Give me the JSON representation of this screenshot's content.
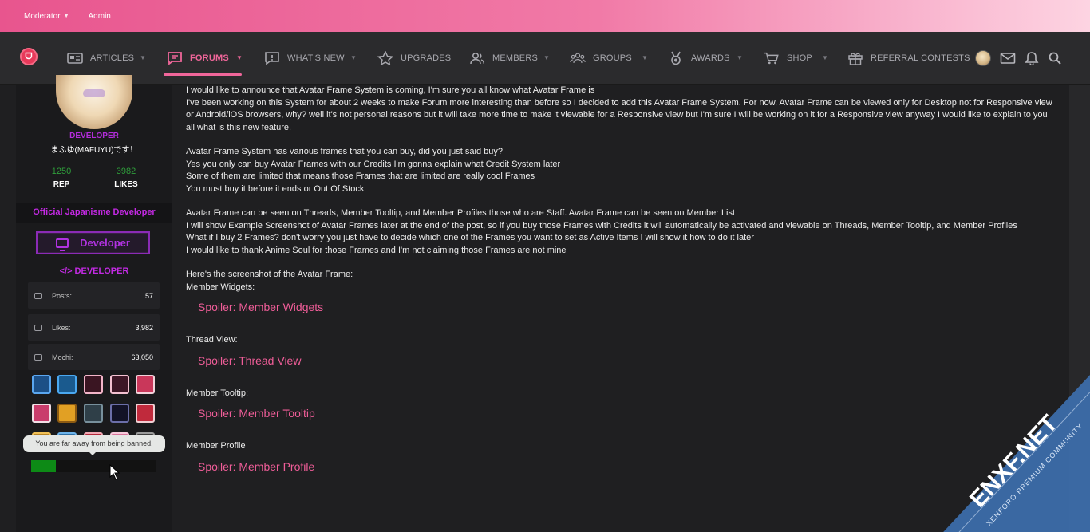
{
  "topbar": {
    "items": [
      "Moderator",
      "Admin"
    ]
  },
  "nav": {
    "items": [
      {
        "label": "ARTICLES",
        "icon": "newspaper-icon"
      },
      {
        "label": "FORUMS",
        "icon": "comment-icon"
      },
      {
        "label": "WHAT'S NEW",
        "icon": "alert-icon"
      },
      {
        "label": "UPGRADES",
        "icon": "star-icon"
      },
      {
        "label": "MEMBERS",
        "icon": "user-group-icon"
      },
      {
        "label": "GROUPS",
        "icon": "users-icon"
      },
      {
        "label": "AWARDS",
        "icon": "medal-icon"
      },
      {
        "label": "SHOP",
        "icon": "cart-icon"
      },
      {
        "label": "REFERRAL CONTESTS",
        "icon": "gift-icon"
      }
    ]
  },
  "sidebar": {
    "role": "DEVELOPER",
    "username": "まふゆ(MAFUYU)です！",
    "stats": [
      {
        "value": "1250",
        "label": "REP"
      },
      {
        "value": "3982",
        "label": "LIKES"
      }
    ],
    "banner": "Official Japanisme Developer",
    "developer_button": "Developer",
    "developer_tag": "</> DEVELOPER",
    "rows": [
      {
        "label": "Posts:",
        "value": "57"
      },
      {
        "label": "Likes:",
        "value": "3,982"
      },
      {
        "label": "Mochi:",
        "value": "63,050"
      }
    ],
    "tooltip": "You are far away from being banned.",
    "progress": 0.2
  },
  "post": {
    "paragraphs": [
      [
        "I would like to announce that Avatar Frame System is coming, I'm sure you all know what Avatar Frame is",
        "I've been working on this System for about 2 weeks to make Forum more interesting than before so I decided to add this Avatar Frame System. For now, Avatar Frame can be viewed only for Desktop not for Responsive view or Android/iOS browsers, why? well it's not personal reasons but it will take more time to make it viewable for a Responsive view but I'm sure I will be working on it for a Responsive view anyway I would like to explain to you all what is this new feature."
      ],
      [
        "Avatar Frame System has various frames that you can buy, did you just said buy?",
        "Yes you only can buy Avatar Frames with our Credits I'm gonna explain what Credit System later",
        "Some of them are limited that means those Frames that are limited are really cool Frames",
        "You must buy it before it ends or Out Of Stock"
      ],
      [
        "Avatar Frame can be seen on Threads, Member Tooltip, and Member Profiles those who are Staff. Avatar Frame can be seen on Member List",
        "I will show Example Screenshot of Avatar Frames later at the end of the post, so if you buy those Frames with Credits it will automatically be activated and viewable on Threads, Member Tooltip, and Member Profiles",
        "What if I buy 2 Frames? don't worry you just have to decide which one of the Frames you want to set as Active Items I will show it how to do it later",
        "I would like to thank Anime Soul for those Frames and I'm not claiming those Frames are not mine"
      ]
    ],
    "screenshot_intro": "Here's the screenshot of the Avatar Frame:",
    "sections": [
      {
        "label": "Member Widgets:",
        "spoiler": "Spoiler: Member Widgets"
      },
      {
        "label": "Thread View:",
        "spoiler": "Spoiler: Thread View"
      },
      {
        "label": "Member Tooltip:",
        "spoiler": "Spoiler: Member Tooltip"
      },
      {
        "label": "Member Profile",
        "spoiler": "Spoiler: Member Profile"
      }
    ]
  },
  "watermark": {
    "brand": "ENXF.NET",
    "tagline": "XENFORO PREMIUM COMMUNITY"
  }
}
